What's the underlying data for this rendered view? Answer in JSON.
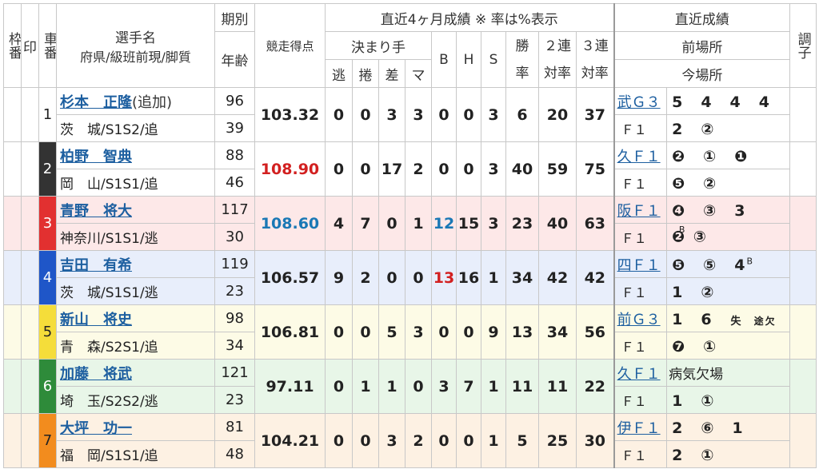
{
  "header": {
    "waku": "枠番",
    "shirushi": "印",
    "sha": "車番",
    "player": "選手名",
    "player_sub": "府県/級班前現/脚質",
    "kibetsu": "期別",
    "nenrei": "年齢",
    "tokuten": "競走得点",
    "recent": "直近4ヶ月成績 ※ 率は%表示",
    "kimarite": "決まり手",
    "k1": "逃",
    "k2": "捲",
    "k3": "差",
    "k4": "マ",
    "b": "B",
    "h": "H",
    "s": "S",
    "win": "勝率",
    "ren2": "２連対率",
    "ren3": "３連対率",
    "latest": "直近成績",
    "mae": "前場所",
    "ima": "今場所",
    "chosi": "調子"
  },
  "rows": [
    {
      "sha": "1",
      "name": "杉本　正隆",
      "tag": "(追加)",
      "pref": "茨　城/S1S2/追",
      "ki": "96",
      "age": "39",
      "score": "103.32",
      "score_color": "#222222",
      "k": [
        "0",
        "0",
        "3",
        "3"
      ],
      "b": "0",
      "h": "0",
      "s": "3",
      "win": "6",
      "r2": "20",
      "r3": "37",
      "prev": "武Ｇ３",
      "prev_res": "5　4　4　4",
      "cur": "Ｆ１",
      "cur_res": "2　②",
      "bg": "#ffffff",
      "waku_bg": "#ffffff",
      "waku_color": "#222222"
    },
    {
      "sha": "2",
      "name": "柏野　智典",
      "tag": "",
      "pref": "岡　山/S1S1/追",
      "ki": "88",
      "age": "46",
      "score": "108.90",
      "score_color": "#d22020",
      "k": [
        "0",
        "0",
        "17",
        "2"
      ],
      "b": "0",
      "h": "0",
      "s": "3",
      "win": "40",
      "r2": "59",
      "r3": "75",
      "prev": "久Ｆ１",
      "prev_res": "❷　①　❶",
      "cur": "Ｆ１",
      "cur_res": "❺　②",
      "bg": "#ffffff",
      "waku_bg": "#333333",
      "waku_color": "#ffffff"
    },
    {
      "sha": "3",
      "name": "青野　将大",
      "tag": "",
      "pref": "神奈川/S1S1/逃",
      "ki": "117",
      "age": "30",
      "score": "108.60",
      "score_color": "#1a78b5",
      "k": [
        "4",
        "7",
        "0",
        "1"
      ],
      "b": "12",
      "h": "15",
      "s": "3",
      "win": "23",
      "r2": "40",
      "r3": "63",
      "prev": "阪Ｆ１",
      "prev_res": "❹　③　3",
      "cur": "Ｆ１",
      "cur_res": "❷ ③",
      "bg": "#fde8e8",
      "waku_bg": "#e23030",
      "waku_color": "#ffffff"
    },
    {
      "sha": "4",
      "name": "吉田　有希",
      "tag": "",
      "pref": "茨　城/S1S1/逃",
      "ki": "119",
      "age": "23",
      "score": "106.57",
      "score_color": "#222222",
      "k": [
        "9",
        "2",
        "0",
        "0"
      ],
      "b": "13",
      "h": "16",
      "s": "1",
      "win": "34",
      "r2": "42",
      "r3": "42",
      "prev": "四Ｆ１",
      "prev_res": "❺　⑤　4",
      "cur": "Ｆ１",
      "cur_res": "1　②",
      "bg": "#e8eefb",
      "waku_bg": "#1f56c8",
      "waku_color": "#ffffff"
    },
    {
      "sha": "5",
      "name": "新山　将史",
      "tag": "",
      "pref": "青　森/S2S1/追",
      "ki": "98",
      "age": "34",
      "score": "106.81",
      "score_color": "#222222",
      "k": [
        "0",
        "0",
        "5",
        "3"
      ],
      "b": "0",
      "h": "0",
      "s": "9",
      "win": "13",
      "r2": "34",
      "r3": "56",
      "prev": "前Ｇ３",
      "prev_res": "1　6",
      "cur": "Ｆ１",
      "cur_res": "❼　①",
      "bg": "#fdfbe6",
      "waku_bg": "#f5dd3a",
      "waku_color": "#222222"
    },
    {
      "sha": "6",
      "name": "加藤　将武",
      "tag": "",
      "pref": "埼　玉/S2S2/逃",
      "ki": "121",
      "age": "23",
      "score": "97.11",
      "score_color": "#222222",
      "k": [
        "0",
        "1",
        "1",
        "0"
      ],
      "b": "3",
      "h": "7",
      "s": "1",
      "win": "11",
      "r2": "11",
      "r3": "22",
      "prev": "久Ｆ１",
      "prev_res": "病気欠場",
      "cur": "Ｆ１",
      "cur_res": "1　①",
      "bg": "#e8f6e8",
      "waku_bg": "#2e8b3a",
      "waku_color": "#ffffff"
    },
    {
      "sha": "7",
      "name": "大坪　功一",
      "tag": "",
      "pref": "福　岡/S1S1/追",
      "ki": "81",
      "age": "48",
      "score": "104.21",
      "score_color": "#222222",
      "k": [
        "0",
        "0",
        "3",
        "2"
      ],
      "b": "0",
      "h": "0",
      "s": "1",
      "win": "5",
      "r2": "25",
      "r3": "30",
      "prev": "伊Ｆ１",
      "prev_res": "2　⑥　1",
      "cur": "Ｆ１",
      "cur_res": "2　①",
      "bg": "#fdf1e3",
      "waku_bg": "#f28c1e",
      "waku_color": "#222222"
    }
  ],
  "extras": {
    "row3_sup": "B",
    "row4_sup": "B",
    "row5_tail1": "失",
    "row5_tail2": "途欠"
  }
}
